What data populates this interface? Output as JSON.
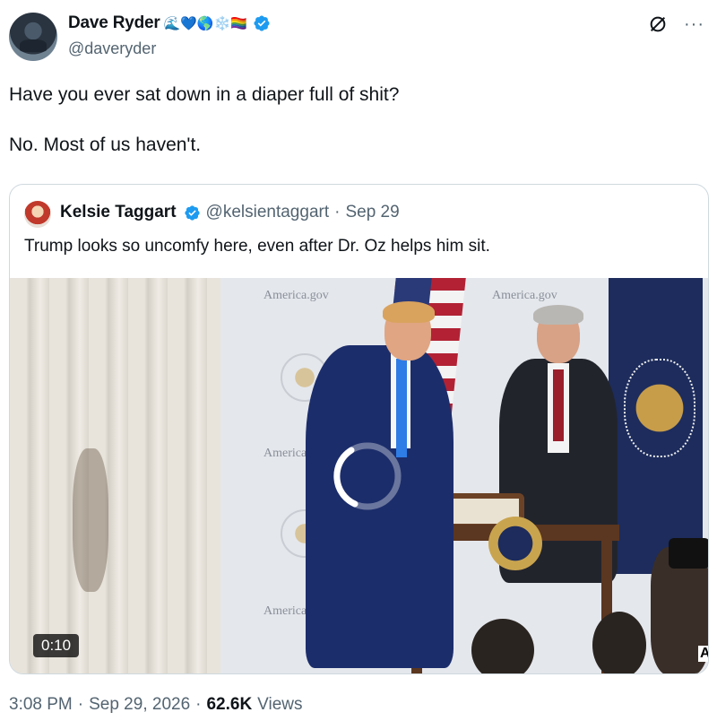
{
  "author": {
    "display_name": "Dave Ryder",
    "emojis": "🌊💙🌎❄️🏳️‍🌈",
    "handle": "@daveryder"
  },
  "icons": {
    "verified": "verified-badge-icon",
    "grok": "grok-icon",
    "more": "more-options-icon"
  },
  "tweet": {
    "text": "Have you ever sat down in a diaper full of shit?\n\nNo. Most of us haven't."
  },
  "quote": {
    "display_name": "Kelsie Taggart",
    "handle": "@kelsientaggart",
    "separator": "·",
    "date": "Sep 29",
    "text": "Trump looks so uncomfy here, even after Dr. Oz helps him sit.",
    "video": {
      "duration": "0:10",
      "backdrop_text": [
        "America.gov",
        "America.gov",
        "America",
        "America.g"
      ],
      "corner_logo": "A"
    }
  },
  "footer": {
    "time": "3:08 PM",
    "separator": "·",
    "date": "Sep 29, 2026",
    "views_count": "62.6K",
    "views_label": "Views"
  },
  "colors": {
    "verified_blue": "#1d9bf0",
    "secondary_text": "#536471",
    "border": "#cfd9de"
  }
}
